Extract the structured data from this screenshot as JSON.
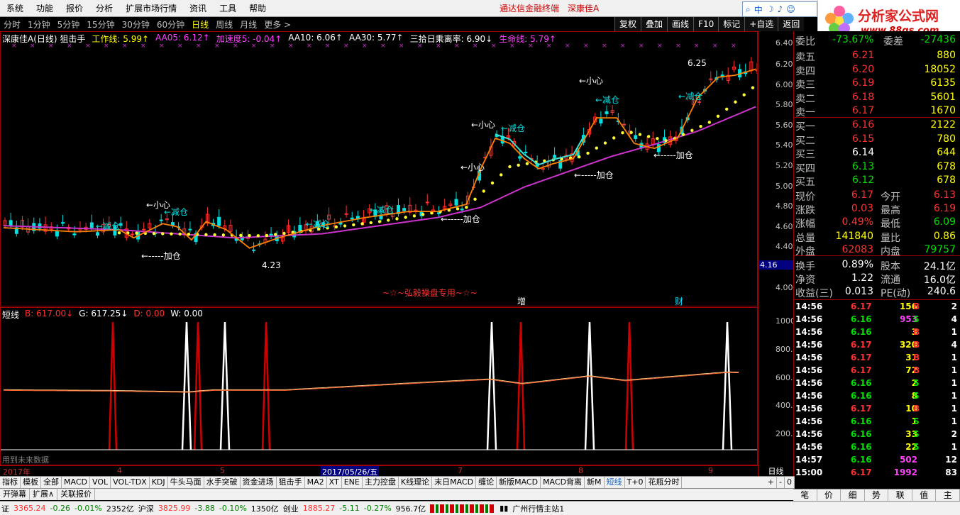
{
  "menu": {
    "items": [
      "系统",
      "功能",
      "报价",
      "分析",
      "扩展市场行情",
      "资讯",
      "工具",
      "帮助"
    ],
    "center_title": "通达信金融终端",
    "stock_title": "深康佳A"
  },
  "search": {
    "label": "中"
  },
  "logo": {
    "line1": "分析家公式网",
    "line2": "www.88gs.com"
  },
  "periods": [
    "分时",
    "1分钟",
    "5分钟",
    "15分钟",
    "30分钟",
    "60分钟",
    "日线",
    "周线",
    "月线",
    "更多 >"
  ],
  "active_period": "日线",
  "right_tools": [
    "复权",
    "叠加",
    "画线",
    "F10",
    "标记",
    "+自选",
    "返回"
  ],
  "info": {
    "name": "深康佳A(日线) 狙击手",
    "work_line": "工作线: 5.99↑",
    "aa05": "AA05: 6.12↑",
    "accel": "加速度5: -0.04↑",
    "aa10": "AA10: 6.06↑",
    "aa30": "AA30: 5.77↑",
    "sanshi": "三拾日乘离率: 6.90↓",
    "life": "生命线: 5.79↑"
  },
  "price_ticks": [
    "6.40",
    "6.20",
    "6.00",
    "5.80",
    "5.60",
    "5.40",
    "5.20",
    "5.00",
    "4.80",
    "4.60",
    "4.40",
    "4.16",
    "4.00"
  ],
  "sub_ticks": [
    "1000",
    "800.0",
    "600.0",
    "400.0",
    "200.0"
  ],
  "annotations": {
    "reduce": "←减仓",
    "careful": "←小心",
    "add": "←-----加仓",
    "low": "4.23",
    "high": "6.25",
    "banner": "~☆~弘毅操盘专用~☆~",
    "zeng": "增",
    "cai": "财"
  },
  "sub_info": {
    "name": "短线",
    "b": "B: 617.00↓",
    "g": "G: 617.25↓",
    "d": "D: 0.00",
    "w": "W: 0.00"
  },
  "future_note": "用到未来数据",
  "dates": [
    "2017年",
    "4",
    "5",
    "2017/05/26/五",
    "7",
    "8",
    "9"
  ],
  "period_label": "日线",
  "bottom_tabs": [
    "指标",
    "模板",
    "全部",
    "MACD",
    "VOL",
    "VOL-TDX",
    "KDJ",
    "牛头马面",
    "水手突破",
    "资金进场",
    "狙击手",
    "MA2",
    "XT",
    "ENE",
    "主力控盘",
    "K线理论",
    "末日MACD",
    "缠论",
    "新版MACD",
    "MACD背离",
    "新M",
    "短线",
    "T+0",
    "花瓶分时"
  ],
  "active_tab": "短线",
  "bottom_tabs2": [
    "开弹幕",
    "扩展∧",
    "关联报价"
  ],
  "quote": {
    "weibi": {
      "label": "委比",
      "value": "-73.67%",
      "label2": "委差",
      "value2": "-27436"
    },
    "sell": [
      {
        "label": "卖五",
        "price": "6.21",
        "vol": "880"
      },
      {
        "label": "卖四",
        "price": "6.20",
        "vol": "18052"
      },
      {
        "label": "卖三",
        "price": "6.19",
        "vol": "6135"
      },
      {
        "label": "卖二",
        "price": "6.18",
        "vol": "5601"
      },
      {
        "label": "卖一",
        "price": "6.17",
        "vol": "1670"
      }
    ],
    "buy": [
      {
        "label": "买一",
        "price": "6.16",
        "vol": "2122"
      },
      {
        "label": "买二",
        "price": "6.15",
        "vol": "780"
      },
      {
        "label": "买三",
        "price": "6.14",
        "vol": "644"
      },
      {
        "label": "买四",
        "price": "6.13",
        "vol": "678"
      },
      {
        "label": "买五",
        "price": "6.12",
        "vol": "678"
      }
    ],
    "stats": [
      {
        "l1": "现价",
        "v1": "6.17",
        "l2": "今开",
        "v2": "6.13"
      },
      {
        "l1": "涨跌",
        "v1": "0.03",
        "l2": "最高",
        "v2": "6.19"
      },
      {
        "l1": "涨幅",
        "v1": "0.49%",
        "l2": "最低",
        "v2": "6.09"
      },
      {
        "l1": "总量",
        "v1": "141840",
        "l2": "量比",
        "v2": "0.86"
      },
      {
        "l1": "外盘",
        "v1": "62083",
        "l2": "内盘",
        "v2": "79757"
      }
    ],
    "stats2": [
      {
        "l1": "换手",
        "v1": "0.89%",
        "l2": "股本",
        "v2": "24.1亿"
      },
      {
        "l1": "净资",
        "v1": "1.22",
        "l2": "流通",
        "v2": "16.0亿"
      },
      {
        "l1": "收益(三)",
        "v1": "0.013",
        "l2": "PE(动)",
        "v2": "240.6"
      }
    ],
    "ticks": [
      {
        "t": "14:56",
        "p": "6.17",
        "v": "156",
        "bs": "B",
        "n": "2"
      },
      {
        "t": "14:56",
        "p": "6.16",
        "v": "953",
        "bs": "S",
        "n": "4"
      },
      {
        "t": "14:56",
        "p": "6.16",
        "v": "3",
        "bs": "B",
        "n": "1"
      },
      {
        "t": "14:56",
        "p": "6.17",
        "v": "320",
        "bs": "B",
        "n": "4"
      },
      {
        "t": "14:56",
        "p": "6.17",
        "v": "31",
        "bs": "B",
        "n": "1"
      },
      {
        "t": "14:56",
        "p": "6.17",
        "v": "72",
        "bs": "B",
        "n": "1"
      },
      {
        "t": "14:56",
        "p": "6.16",
        "v": "2",
        "bs": "S",
        "n": "1"
      },
      {
        "t": "14:56",
        "p": "6.16",
        "v": "8",
        "bs": "S",
        "n": "1"
      },
      {
        "t": "14:56",
        "p": "6.17",
        "v": "10",
        "bs": "B",
        "n": "1"
      },
      {
        "t": "14:56",
        "p": "6.16",
        "v": "1",
        "bs": "S",
        "n": "1"
      },
      {
        "t": "14:56",
        "p": "6.16",
        "v": "33",
        "bs": "S",
        "n": "2"
      },
      {
        "t": "14:56",
        "p": "6.16",
        "v": "22",
        "bs": "S",
        "n": "1"
      },
      {
        "t": "14:57",
        "p": "6.16",
        "v": "502",
        "bs": "",
        "n": "12"
      },
      {
        "t": "15:00",
        "p": "6.17",
        "v": "1992",
        "bs": "",
        "n": "83"
      }
    ]
  },
  "right_tabs": [
    "笔",
    "价",
    "细",
    "势",
    "联",
    "值",
    "主"
  ],
  "status": {
    "sh_label": "证",
    "sh_val": "3365.24",
    "sh_chg": "-0.26",
    "sh_pct": "-0.01%",
    "sh_amt": "2352亿",
    "sz_label": "沪深",
    "sz_val": "3825.99",
    "sz_chg": "-3.88",
    "sz_pct": "-0.10%",
    "sz_amt": "1350亿",
    "cy_label": "创业",
    "cy_val": "1885.27",
    "cy_chg": "-5.11",
    "cy_pct": "-0.27%",
    "cy_amt": "956.7亿",
    "server": "广州行情主站1"
  },
  "colors": {
    "up": "#ff3030",
    "down": "#00ffff",
    "ma_orange": "#ff8000",
    "life_line": "#cc33cc",
    "dots": "#ffff33"
  }
}
